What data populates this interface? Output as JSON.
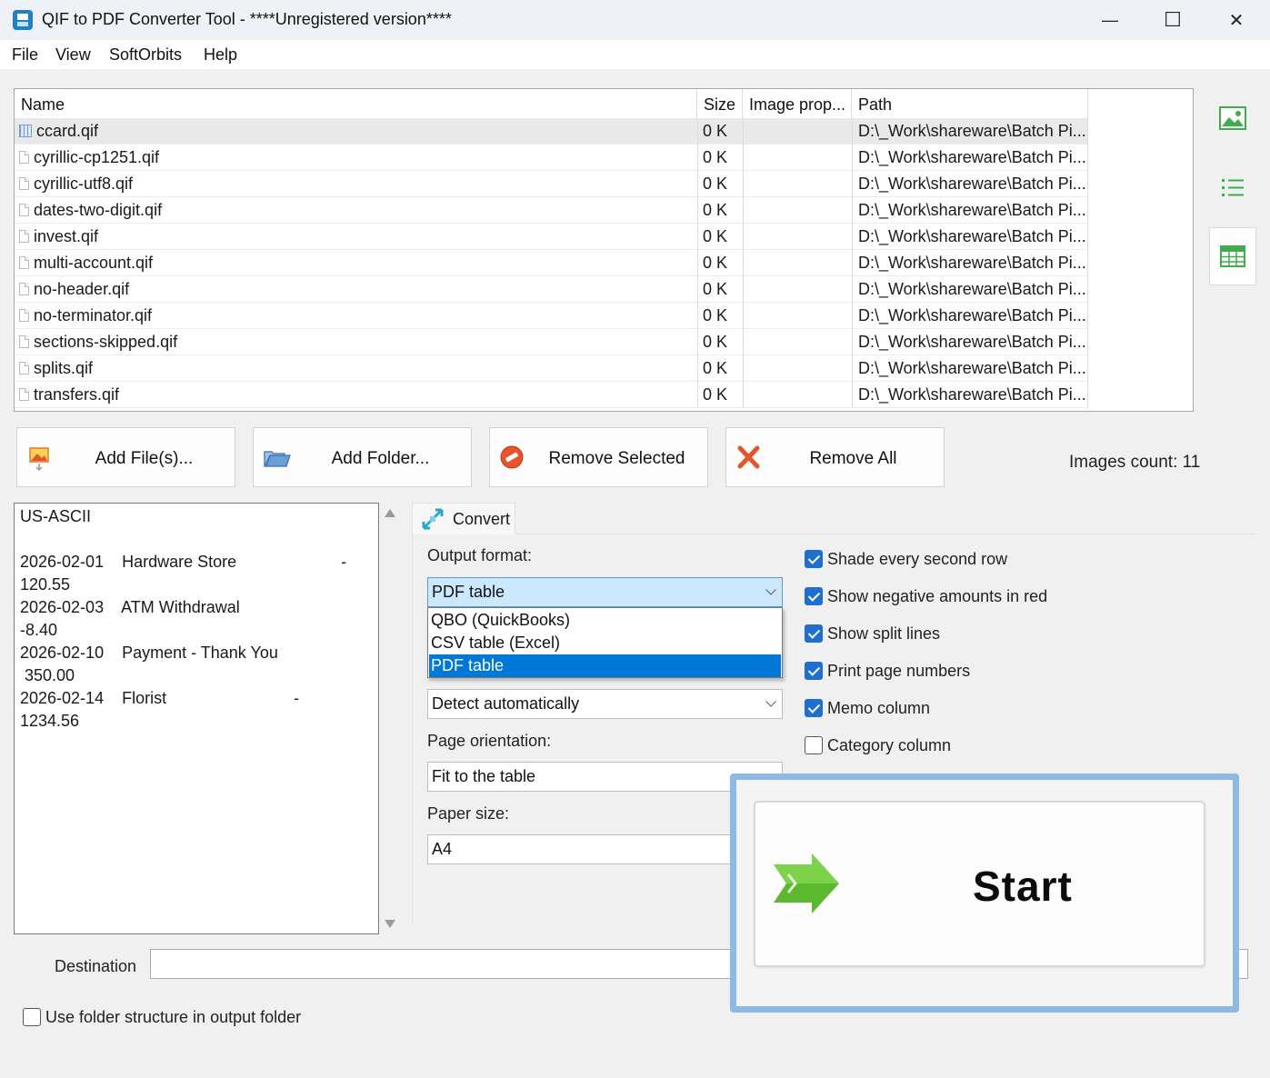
{
  "window": {
    "title": "QIF to PDF Converter Tool - ****Unregistered version****",
    "controls": {
      "minimize": "—",
      "maximize": "☐",
      "close": "✕"
    }
  },
  "menu": [
    {
      "label": "File"
    },
    {
      "label": "View"
    },
    {
      "label": "SoftOrbits"
    },
    {
      "label": "Help"
    }
  ],
  "file_list": {
    "columns": [
      "Name",
      "Size",
      "Image prop...",
      "Path"
    ],
    "rows": [
      {
        "name": "ccard.qif",
        "size": "0 K",
        "image_prop": "",
        "path": "D:\\_Work\\shareware\\Batch Pi..."
      },
      {
        "name": "cyrillic-cp1251.qif",
        "size": "0 K",
        "image_prop": "",
        "path": "D:\\_Work\\shareware\\Batch Pi..."
      },
      {
        "name": "cyrillic-utf8.qif",
        "size": "0 K",
        "image_prop": "",
        "path": "D:\\_Work\\shareware\\Batch Pi..."
      },
      {
        "name": "dates-two-digit.qif",
        "size": "0 K",
        "image_prop": "",
        "path": "D:\\_Work\\shareware\\Batch Pi..."
      },
      {
        "name": "invest.qif",
        "size": "0 K",
        "image_prop": "",
        "path": "D:\\_Work\\shareware\\Batch Pi..."
      },
      {
        "name": "multi-account.qif",
        "size": "0 K",
        "image_prop": "",
        "path": "D:\\_Work\\shareware\\Batch Pi..."
      },
      {
        "name": "no-header.qif",
        "size": "0 K",
        "image_prop": "",
        "path": "D:\\_Work\\shareware\\Batch Pi..."
      },
      {
        "name": "no-terminator.qif",
        "size": "0 K",
        "image_prop": "",
        "path": "D:\\_Work\\shareware\\Batch Pi..."
      },
      {
        "name": "sections-skipped.qif",
        "size": "0 K",
        "image_prop": "",
        "path": "D:\\_Work\\shareware\\Batch Pi..."
      },
      {
        "name": "splits.qif",
        "size": "0 K",
        "image_prop": "",
        "path": "D:\\_Work\\shareware\\Batch Pi..."
      },
      {
        "name": "transfers.qif",
        "size": "0 K",
        "image_prop": "",
        "path": "D:\\_Work\\shareware\\Batch Pi..."
      }
    ]
  },
  "side_toolbar": [
    "image-view-icon",
    "list-view-icon",
    "table-view-icon"
  ],
  "actions": {
    "add_files": "Add File(s)...",
    "add_folder": "Add Folder...",
    "remove_selected": "Remove Selected",
    "remove_all": "Remove All",
    "images_count": "Images count: 11"
  },
  "preview": {
    "lines": [
      "US-ASCII",
      "",
      "2026-02-01    Hardware Store                       -",
      "120.55",
      "2026-02-03    ATM Withdrawal",
      "-8.40",
      "2026-02-10    Payment - Thank You",
      " 350.00",
      "2026-02-14    Florist                            -",
      "1234.56"
    ]
  },
  "convert": {
    "tab_label": "Convert",
    "output_format_label": "Output format:",
    "output_format_value": "PDF table",
    "output_format_options": [
      "QBO (QuickBooks)",
      "CSV table (Excel)",
      "PDF table"
    ],
    "encoding_value": "Detect automatically",
    "page_orientation_label": "Page orientation:",
    "page_orientation_value": "Fit to the table",
    "paper_size_label": "Paper size:",
    "paper_size_value": "A4",
    "options": [
      {
        "label": "Shade every second row",
        "checked": true
      },
      {
        "label": "Show negative amounts in red",
        "checked": true
      },
      {
        "label": "Show split lines",
        "checked": true
      },
      {
        "label": "Print page numbers",
        "checked": true
      },
      {
        "label": "Memo column",
        "checked": true
      },
      {
        "label": "Category column",
        "checked": false
      }
    ]
  },
  "destination": {
    "label": "Destination",
    "value": "",
    "folder_structure_label": "Use folder structure in output folder"
  },
  "start": {
    "label": "Start"
  },
  "colors": {
    "accent": "#0078d7",
    "checkbox": "#1f6fd0",
    "highlight_frame": "#8db9e3",
    "start_arrow": "#5cb82e"
  }
}
